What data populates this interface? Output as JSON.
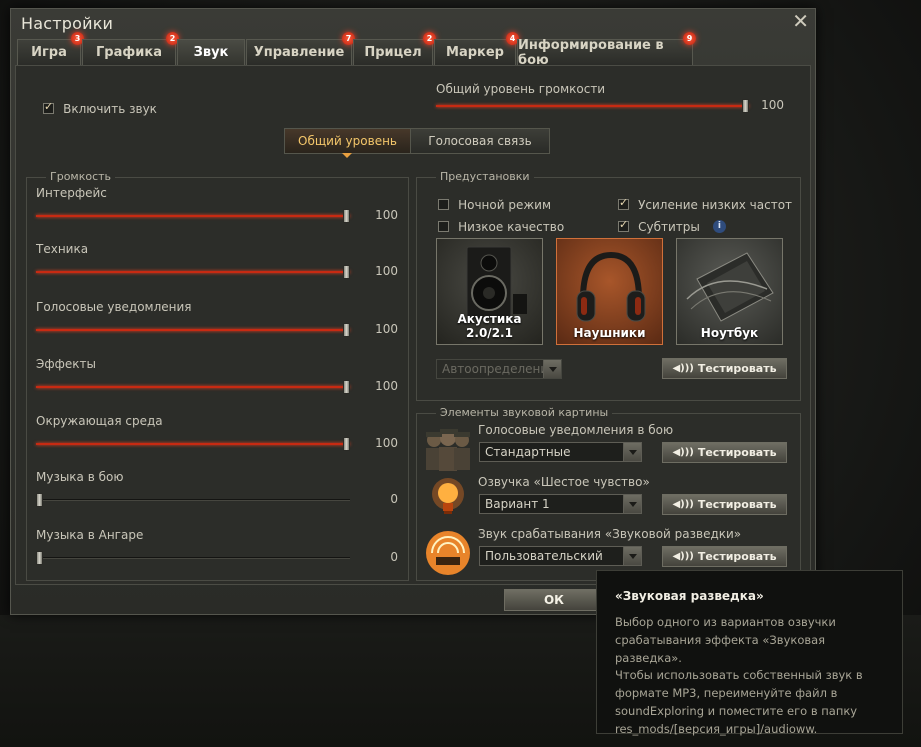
{
  "window": {
    "title": "Настройки"
  },
  "tabs": [
    {
      "label": "Игра",
      "badge": "3"
    },
    {
      "label": "Графика",
      "badge": "2"
    },
    {
      "label": "Звук",
      "badge": ""
    },
    {
      "label": "Управление",
      "badge": "7"
    },
    {
      "label": "Прицел",
      "badge": "2"
    },
    {
      "label": "Маркер",
      "badge": "4"
    },
    {
      "label": "Информирование в бою",
      "badge": "9"
    }
  ],
  "enable_sound": {
    "label": "Включить звук",
    "checked": true
  },
  "master": {
    "label": "Общий уровень громкости",
    "value": "100",
    "level": 1.0
  },
  "mode_tabs": {
    "general": "Общий уровень",
    "voice": "Голосовая связь"
  },
  "volume": {
    "legend": "Громкость",
    "items": [
      {
        "label": "Интерфейс",
        "value": "100",
        "level": 1.0
      },
      {
        "label": "Техника",
        "value": "100",
        "level": 1.0
      },
      {
        "label": "Голосовые уведомления",
        "value": "100",
        "level": 1.0
      },
      {
        "label": "Эффекты",
        "value": "100",
        "level": 1.0
      },
      {
        "label": "Окружающая среда",
        "value": "100",
        "level": 1.0
      },
      {
        "label": "Музыка в бою",
        "value": "0",
        "level": 0.0
      },
      {
        "label": "Музыка в Ангаре",
        "value": "0",
        "level": 0.0
      }
    ]
  },
  "presets": {
    "legend": "Предустановки",
    "night_mode": {
      "label": "Ночной режим",
      "checked": false
    },
    "low_quality": {
      "label": "Низкое качество",
      "checked": false
    },
    "bass_boost": {
      "label": "Усиление низких частот",
      "checked": true
    },
    "subtitles": {
      "label": "Субтитры",
      "checked": true
    },
    "info_icon": "i",
    "devices": [
      {
        "label": "Акустика 2.0/2.1",
        "icon": "speaker-icon",
        "selected": false
      },
      {
        "label": "Наушники",
        "icon": "headphones-icon",
        "selected": true
      },
      {
        "label": "Ноутбук",
        "icon": "laptop-icon",
        "selected": false
      }
    ],
    "auto_detect": "Автоопределение",
    "test_button": "Тестировать"
  },
  "elements": {
    "legend": "Элементы звуковой картины",
    "rows": [
      {
        "label": "Голосовые уведомления в бою",
        "value": "Стандартные",
        "icon": "crew-icon",
        "test": "Тестировать"
      },
      {
        "label": "Озвучка «Шестое чувство»",
        "value": "Вариант 1",
        "icon": "lightbulb-icon",
        "test": "Тестировать"
      },
      {
        "label": "Звук срабатывания «Звуковой разведки»",
        "value": "Пользовательский",
        "icon": "sound-exploring-icon",
        "test": "Тестировать"
      }
    ]
  },
  "ok_button": "ОК",
  "tooltip": {
    "title": "«Звуковая разведка»",
    "body": "Выбор одного из вариантов озвучки\nсрабатывания эффекта «Звуковая разведка».\nЧтобы использовать собственный звук в\nформате MP3, переименуйте файл в\nsoundExploring и поместите его в папку\nres_mods/[версия_игры]/audioww."
  },
  "colors": {
    "accent": "#c82a12",
    "tab_selected": "#f3c66a",
    "badge": "#d8321a"
  }
}
